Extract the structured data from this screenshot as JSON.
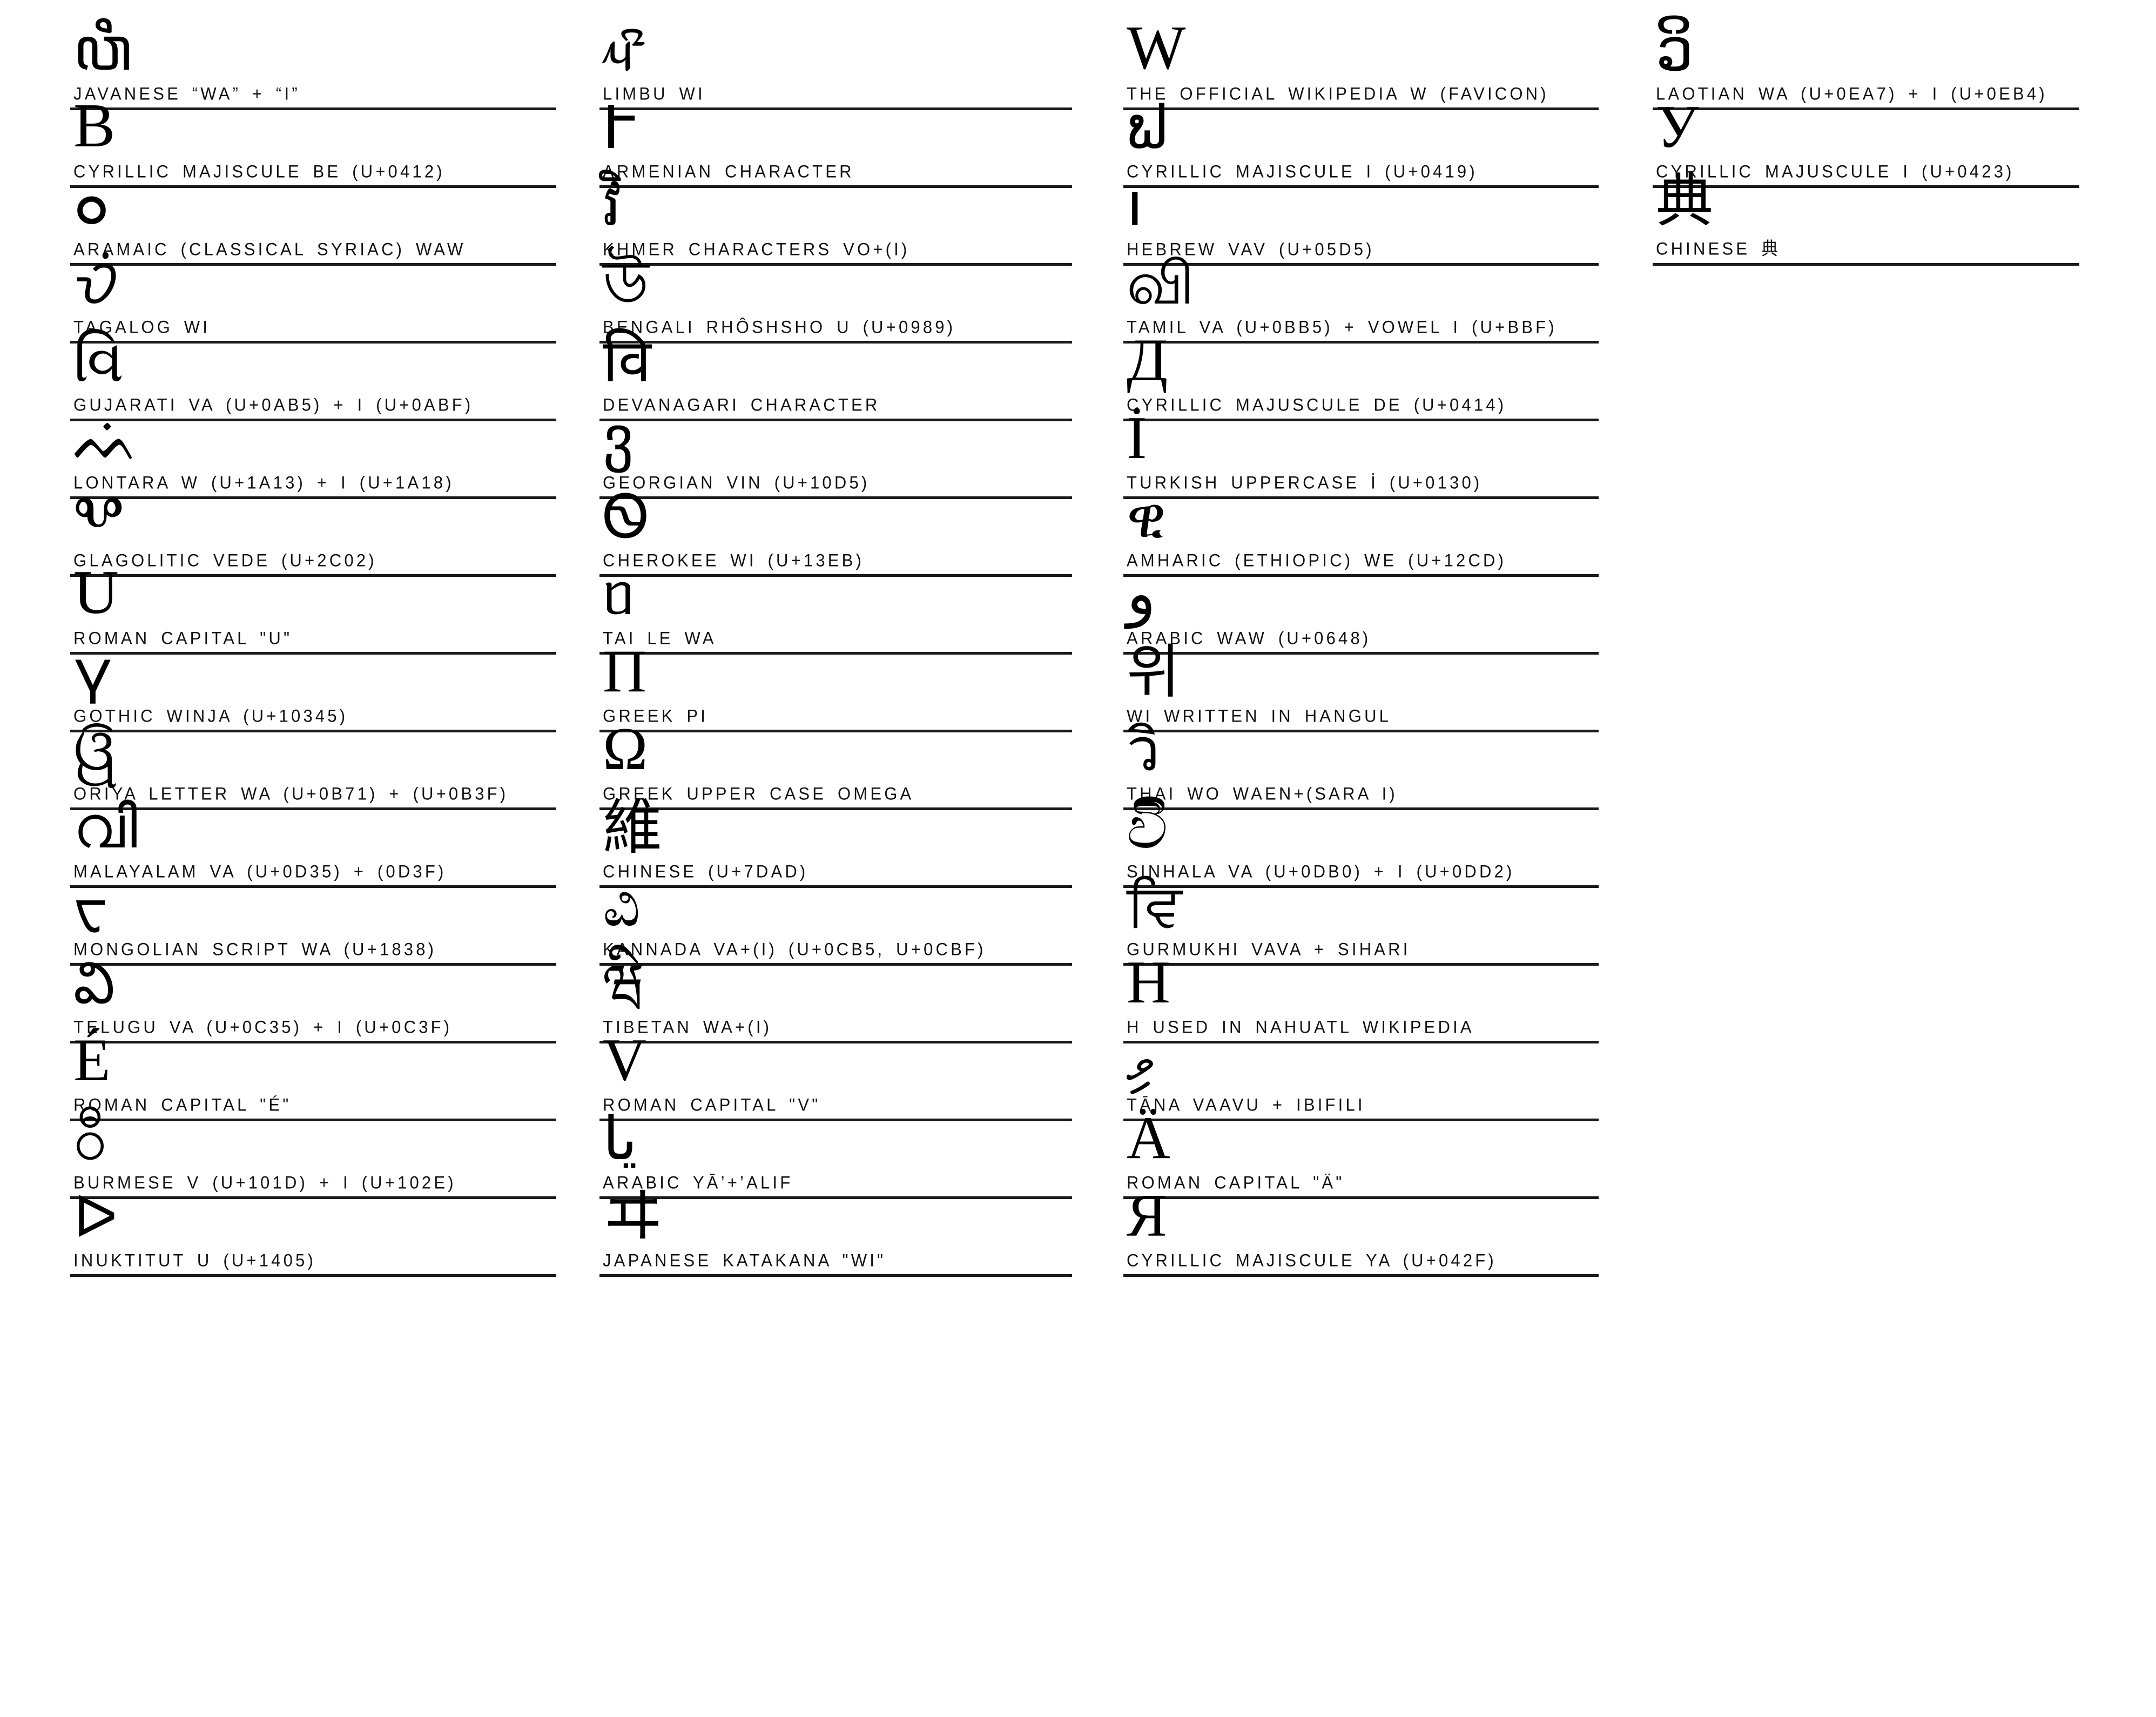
{
  "sheet": {
    "title": "Wikipedia \"Wi\" glyph variants across world scripts",
    "background_color": "#ffffff",
    "text_color": "#000000",
    "rule_color": "#1a1a1a",
    "column_count": 4
  },
  "columns": [
    {
      "index": 0,
      "entries": [
        {
          "glyph": "A0",
          "glyph_text": "ꦮꦶ",
          "caption": "JAVANESE “WA” + “I”",
          "glyph_size": 112,
          "serif": false
        },
        {
          "glyph_text": "В",
          "caption": "CYRILLIC MAJISCULE BE (U+0412)",
          "glyph_size": 116,
          "serif": true
        },
        {
          "glyph_text": "ܘ",
          "caption": "ARAMAIC (CLASSICAL SYRIAC) WAW",
          "glyph_size": 120,
          "serif": false
        },
        {
          "glyph_text": "ᜏᜒ",
          "caption": "TAGALOG WI",
          "glyph_size": 110,
          "serif": false
        },
        {
          "glyph_text": "વિ",
          "caption": "GUJARATI VA (U+0AB5) + I (U+0ABF)",
          "glyph_size": 110,
          "serif": false
        },
        {
          "glyph_text": "ᨓᨗ",
          "caption": "LONTARA W (U+1A13) + I (U+1A18)",
          "glyph_size": 104,
          "serif": false
        },
        {
          "glyph_text": "Ⰲ",
          "caption": "GLAGOLITIC VEDE (U+2C02)",
          "glyph_size": 110,
          "serif": false
        },
        {
          "glyph_text": "U",
          "caption": "ROMAN CAPITAL \"U\"",
          "glyph_size": 116,
          "serif": true
        },
        {
          "glyph_text": "𐍅",
          "caption": "GOTHIC WINJA (U+10345)",
          "glyph_size": 112,
          "serif": true
        },
        {
          "glyph_text": "ୱି",
          "caption": "ORIYA LETTER WA (U+0B71) + (U+0B3F)",
          "glyph_size": 110,
          "serif": false
        },
        {
          "glyph_text": "വി",
          "caption": "MALAYALAM VA (U+0D35) + (0D3F)",
          "glyph_size": 108,
          "serif": false
        },
        {
          "glyph_text": "ᠸ",
          "caption": "MONGOLIAN SCRIPT WA (U+1838)",
          "glyph_size": 106,
          "serif": false
        },
        {
          "glyph_text": "వి",
          "caption": "TELUGU VA (U+0C35) + I (U+0C3F)",
          "glyph_size": 108,
          "serif": false
        },
        {
          "glyph_text": "É",
          "caption": "ROMAN CAPITAL \"É\"",
          "glyph_size": 112,
          "serif": true
        },
        {
          "glyph_text": "ဝီ",
          "caption": "BURMESE V (U+101D) + I (U+102E)",
          "glyph_size": 110,
          "serif": false
        },
        {
          "glyph_text": "ᐅ",
          "caption": "INUKTITUT U (U+1405)",
          "glyph_size": 106,
          "serif": false
        }
      ]
    },
    {
      "index": 1,
      "entries": [
        {
          "glyph_text": "ᤘᤡ",
          "caption": "LIMBU WI",
          "glyph_size": 110,
          "serif": false
        },
        {
          "glyph_text": "Ւ",
          "caption": "ARMENIAN CHARACTER",
          "glyph_size": 110,
          "serif": false
        },
        {
          "glyph_text": "វិ",
          "caption": "KHMER CHARACTERS VO+(I)",
          "glyph_size": 108,
          "serif": false
        },
        {
          "glyph_text": "উ",
          "caption": "BENGALI RHÔSHSHO U (U+0989)",
          "glyph_size": 110,
          "serif": false
        },
        {
          "glyph_text": "वि",
          "caption": "DEVANAGARI CHARACTER",
          "glyph_size": 110,
          "serif": false
        },
        {
          "glyph_text": "ვ",
          "caption": "GEORGIAN VIN (U+10D5)",
          "glyph_size": 112,
          "serif": false
        },
        {
          "glyph_text": "Ꮻ",
          "caption": "CHEROKEE WI (U+13EB)",
          "glyph_size": 110,
          "serif": false
        },
        {
          "glyph_text": "ᥝ",
          "caption": "TAI LE WA",
          "glyph_size": 108,
          "serif": false
        },
        {
          "glyph_text": "Π",
          "caption": "GREEK PI",
          "glyph_size": 112,
          "serif": true
        },
        {
          "glyph_text": "Ω",
          "caption": "GREEK UPPER CASE OMEGA",
          "glyph_size": 112,
          "serif": true
        },
        {
          "glyph_text": "維",
          "caption": "CHINESE (U+7DAD)",
          "glyph_size": 110,
          "serif": false
        },
        {
          "glyph_text": "ವಿ",
          "caption": "KANNADA VA+(I) (U+0CB5, U+0CBF)",
          "glyph_size": 108,
          "serif": false
        },
        {
          "glyph_text": "ཝི",
          "caption": "TIBETAN WA+(I)",
          "glyph_size": 104,
          "serif": false
        },
        {
          "glyph_text": "V",
          "caption": "ROMAN CAPITAL \"V\"",
          "glyph_size": 112,
          "serif": true
        },
        {
          "glyph_text": "يا",
          "caption": "ARABIC YĀ’+’ALIF",
          "glyph_size": 110,
          "serif": false
        },
        {
          "glyph_text": "ヰ",
          "caption": "JAPANESE KATAKANA \"WI\"",
          "glyph_size": 112,
          "serif": false
        }
      ]
    },
    {
      "index": 2,
      "entries": [
        {
          "glyph_text": "W",
          "caption": "THE OFFICIAL WIKIPEDIA W (FAVICON)",
          "glyph_size": 116,
          "serif": true
        },
        {
          "glyph_text": "ຟ",
          "caption": "CYRILLIC MAJISCULE I (U+0419)",
          "glyph_size": 110,
          "serif": false
        },
        {
          "glyph_text": "ו",
          "caption": "HEBREW VAV (U+05D5)",
          "glyph_size": 112,
          "serif": false
        },
        {
          "glyph_text": "வி",
          "caption": "TAMIL VA (U+0BB5) + VOWEL I (U+BBF)",
          "glyph_size": 110,
          "serif": false
        },
        {
          "glyph_text": "Д",
          "caption": "CYRILLIC MAJUSCULE DE (U+0414)",
          "glyph_size": 112,
          "serif": true
        },
        {
          "glyph_text": "İ",
          "caption": "TURKISH UPPERCASE İ (U+0130)",
          "glyph_size": 112,
          "serif": true
        },
        {
          "glyph_text": "ዊ",
          "caption": "AMHARIC (ETHIOPIC) WE (U+12CD)",
          "glyph_size": 106,
          "serif": false
        },
        {
          "glyph_text": "و",
          "caption": "ARABIC WAW (U+0648)",
          "glyph_size": 112,
          "serif": false
        },
        {
          "glyph_text": "위",
          "caption": "WI WRITTEN IN HANGUL",
          "glyph_size": 108,
          "serif": false
        },
        {
          "glyph_text": "วิ",
          "caption": "THAI WO WAEN+(SARA I)",
          "glyph_size": 110,
          "serif": false
        },
        {
          "glyph_text": "විි",
          "caption": "SINHALA VA (U+0DB0) + I (U+0DD2)",
          "glyph_size": 106,
          "serif": false
        },
        {
          "glyph_text": "ਵਿ",
          "caption": "GURMUKHI VAVA  + SIHARI",
          "glyph_size": 108,
          "serif": false
        },
        {
          "glyph_text": "H",
          "caption": "H USED IN NAHUATL WIKIPEDIA",
          "glyph_size": 112,
          "serif": true
        },
        {
          "glyph_text": "ވި",
          "caption": "TĀNA VAAVU + IBIFILI",
          "glyph_size": 110,
          "serif": false
        },
        {
          "glyph_text": "Ä",
          "caption": "ROMAN CAPITAL \"Ä\"",
          "glyph_size": 112,
          "serif": true
        },
        {
          "glyph_text": "Я",
          "caption": "CYRILLIC MAJISCULE YA (U+042F)",
          "glyph_size": 112,
          "serif": true
        }
      ]
    },
    {
      "index": 3,
      "entries": [
        {
          "glyph_text": "ວິ",
          "caption": "LAOTIAN WA (U+0EA7) + I (U+0EB4)",
          "glyph_size": 110,
          "serif": false
        },
        {
          "glyph_text": "У",
          "caption": "CYRILLIC MAJUSCULE I (U+0423)",
          "glyph_size": 112,
          "serif": true
        },
        {
          "glyph_text": "典",
          "caption": "CHINESE 典",
          "glyph_size": 106,
          "serif": false
        }
      ]
    }
  ]
}
